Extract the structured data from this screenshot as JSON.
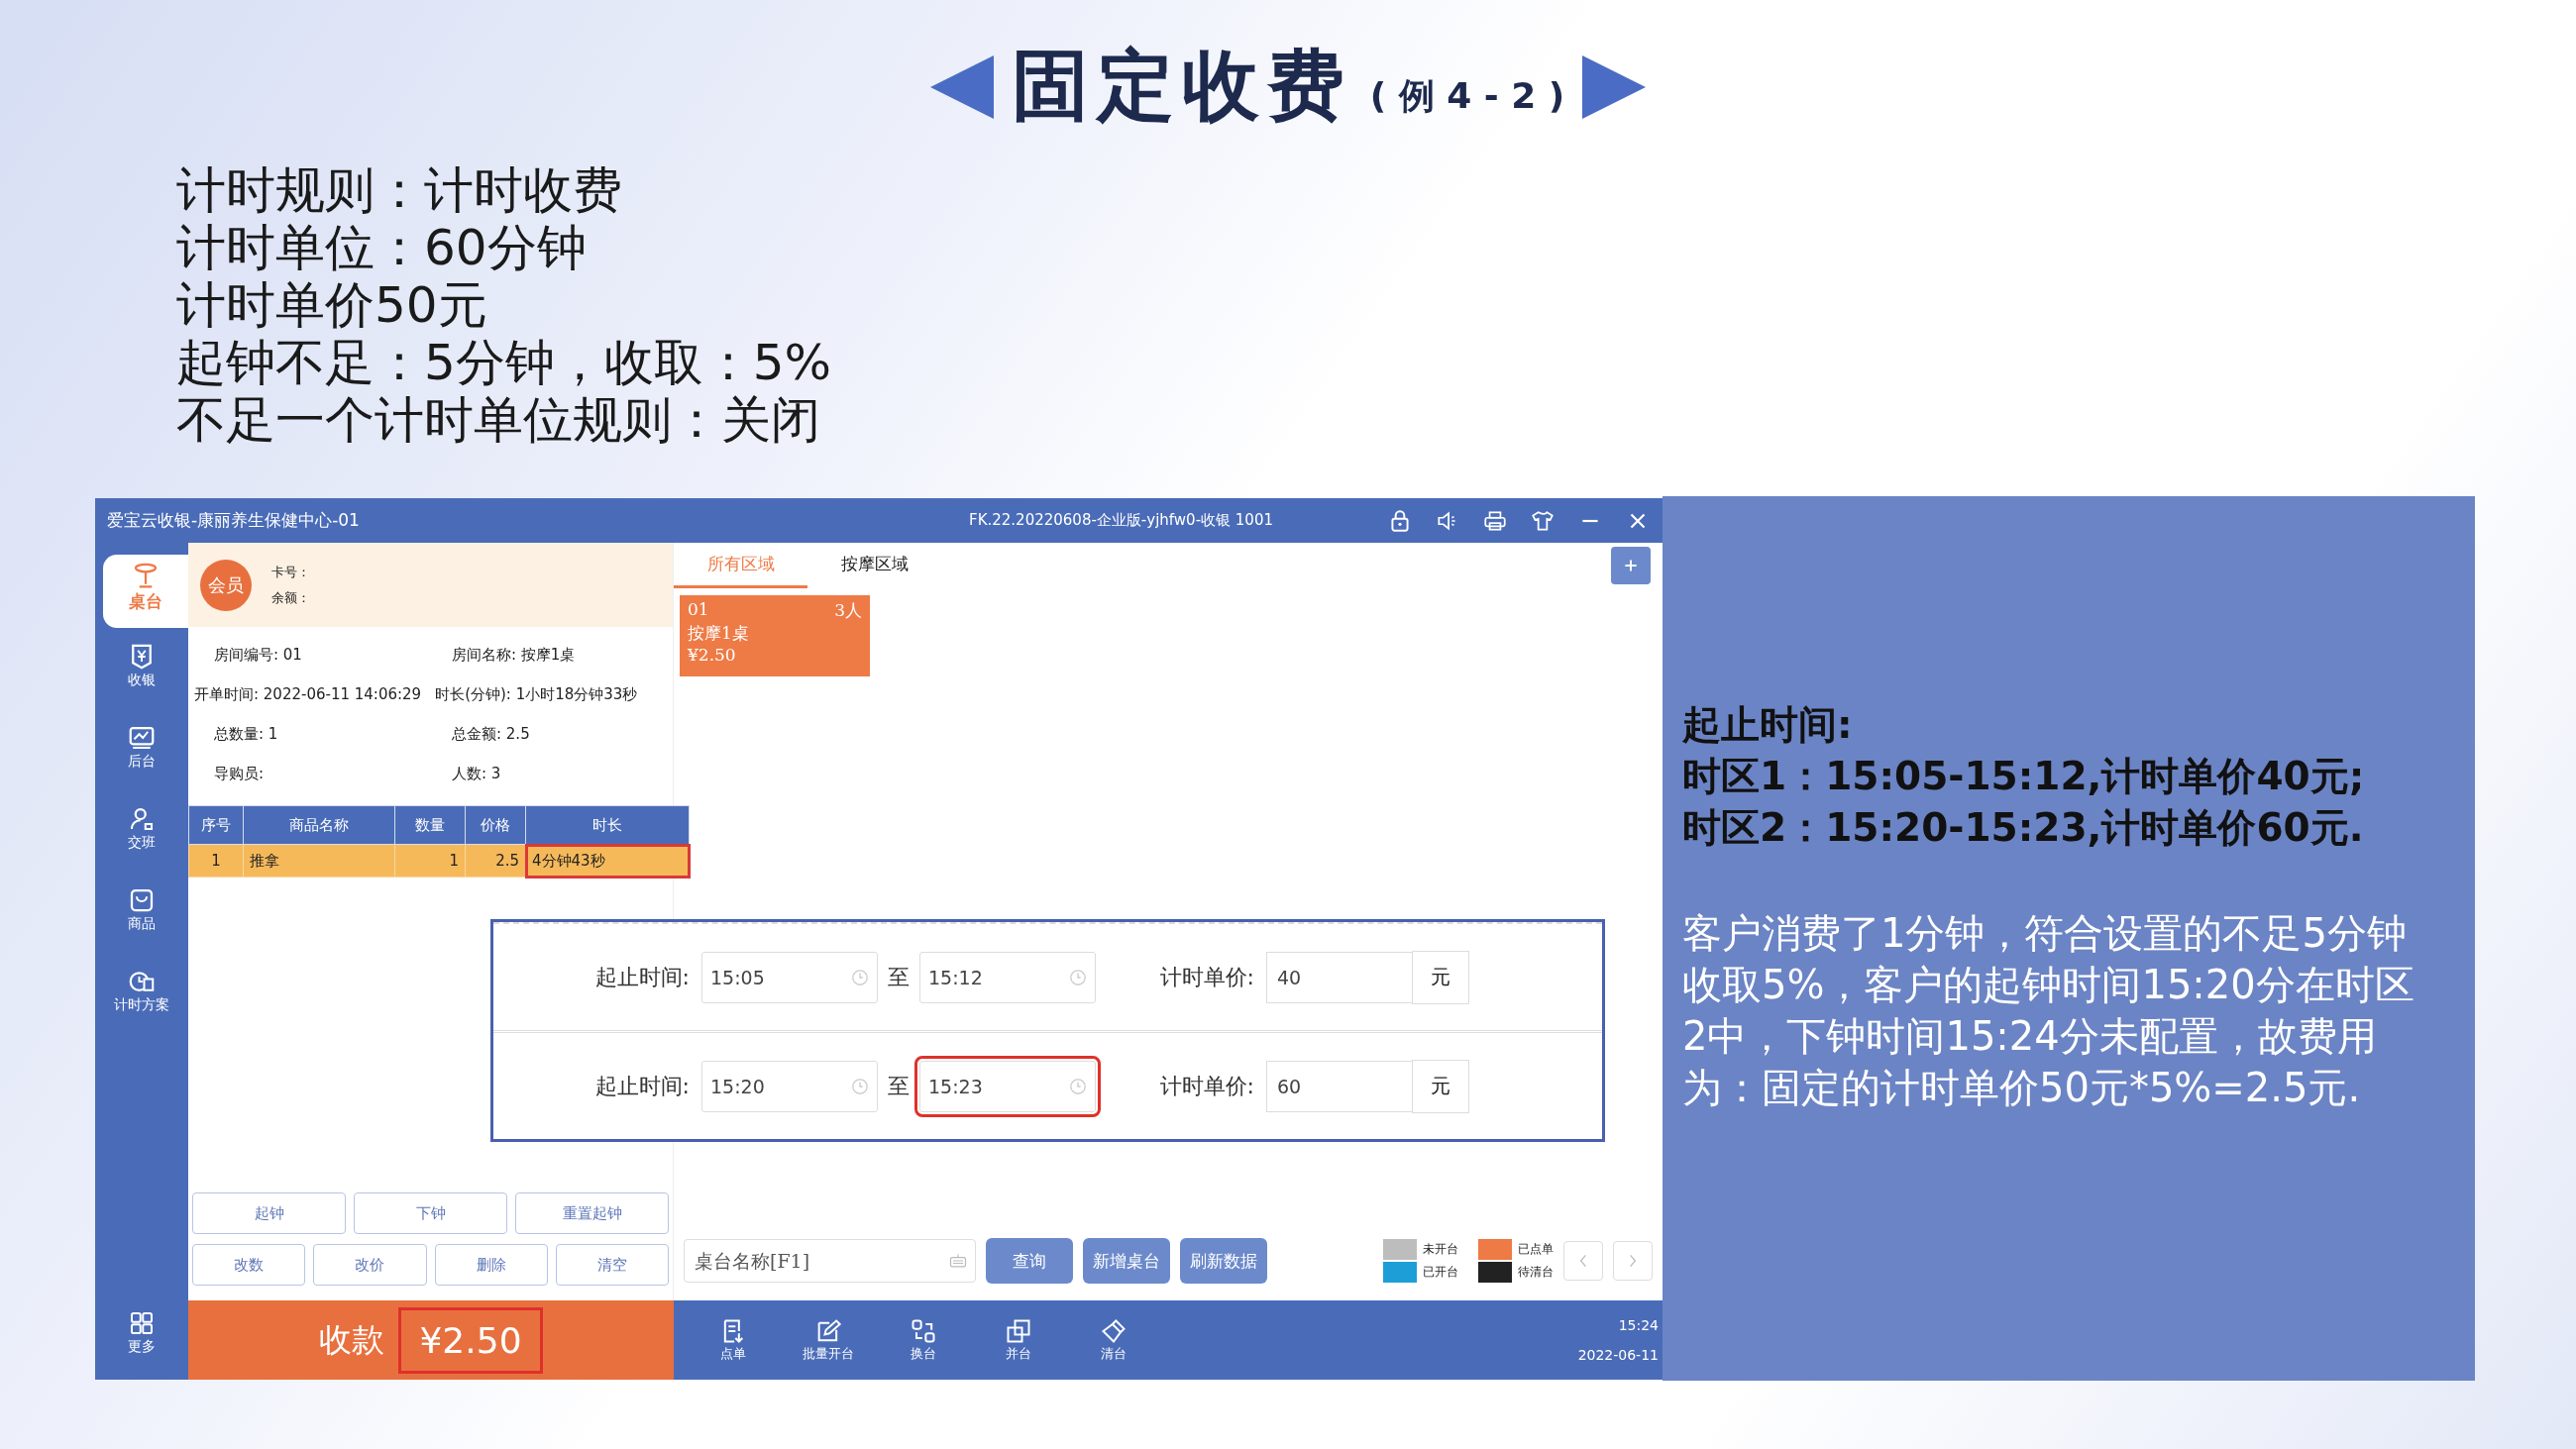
{
  "slide": {
    "title": "固定收费",
    "subtitle": "( 例 4 - 2 )",
    "rules": [
      "计时规则：计时收费",
      "计时单位：60分钟",
      "计时单价50元",
      "起钟不足：5分钟，收取：5%",
      "不足一个计时单位规则：关闭"
    ]
  },
  "app": {
    "window_title": "爱宝云收银-康丽养生保健中心-01",
    "version": "FK.22.20220608-企业版-yjhfw0-收银 1001",
    "sidebar": [
      {
        "label": "桌台",
        "selected": true
      },
      {
        "label": "收银",
        "selected": false
      },
      {
        "label": "后台",
        "selected": false
      },
      {
        "label": "交班",
        "selected": false
      },
      {
        "label": "商品",
        "selected": false
      },
      {
        "label": "计时方案",
        "selected": false
      }
    ],
    "sidebar_more": "更多",
    "member": {
      "badge": "会员",
      "card_label": "卡号：",
      "balance_label": "余额："
    },
    "info_rows": [
      [
        {
          "label": "房间编号:",
          "value": "01"
        },
        {
          "label": "房间名称:",
          "value": "按摩1桌"
        }
      ],
      [
        {
          "label": "开单时间:",
          "value": "2022-06-11 14:06:29"
        },
        {
          "label": "时长(分钟):",
          "value": "1小时18分钟33秒"
        }
      ],
      [
        {
          "label": "总数量:",
          "value": "1"
        },
        {
          "label": "总金额:",
          "value": "2.5"
        }
      ],
      [
        {
          "label": "导购员:"
        },
        {
          "label": "人数:",
          "value": "3"
        }
      ]
    ],
    "table": {
      "columns": [
        "序号",
        "商品名称",
        "数量",
        "价格",
        "时长"
      ],
      "rows": [
        {
          "cells": [
            "1",
            "推拿",
            "1",
            "2.5",
            "4分钟43秒"
          ],
          "selected": true,
          "duration_highlighted": true
        }
      ]
    },
    "order_buttons": [
      [
        "起钟",
        "下钟",
        "重置起钟"
      ],
      [
        "改数",
        "改价",
        "删除",
        "清空"
      ]
    ],
    "checkout": {
      "label": "收款",
      "amount": "¥2.50",
      "highlighted": true
    },
    "tabs": [
      {
        "label": "所有区域",
        "selected": true
      },
      {
        "label": "按摩区域",
        "selected": false
      }
    ],
    "tables_grid": [
      {
        "number": "01",
        "people": "3人",
        "name": "按摩1桌",
        "price": "¥2.50",
        "color": "#ee7a45"
      }
    ],
    "search": {
      "placeholder": "桌台名称[F1]"
    },
    "actions": [
      "查询",
      "新增桌台",
      "刷新数据"
    ],
    "legend": [
      {
        "label": "未开台",
        "color": "#bdbdbd"
      },
      {
        "label": "已点单",
        "color": "#ee7a45"
      },
      {
        "label": "已开台",
        "color": "#1e9ed6"
      },
      {
        "label": "待清台",
        "color": "#222222"
      }
    ],
    "toolbar": [
      "点单",
      "批量开台",
      "换台",
      "并台",
      "清台"
    ],
    "clock": {
      "time": "15:24",
      "date": "2022-06-11"
    },
    "time_config": [
      {
        "label": "起止时间:",
        "start": "15:05",
        "to": "至",
        "end": "15:12",
        "price_label": "计时单价:",
        "price": "40",
        "unit": "元",
        "end_highlighted": false
      },
      {
        "label": "起止时间:",
        "start": "15:20",
        "to": "至",
        "end": "15:23",
        "price_label": "计时单价:",
        "price": "60",
        "unit": "元",
        "end_highlighted": true
      }
    ]
  },
  "explanation": {
    "heading": [
      "起止时间:",
      "时区1：15:05-15:12,计时单价40元;",
      "时区2：15:20-15:23,计时单价60元."
    ],
    "paragraph": "客户消费了1分钟，符合设置的不足5分钟收取5%，客户的起钟时间15:20分在时区2中，下钟时间15:24分未配置，故费用为：固定的计时单价50元*5%=2.5元."
  }
}
